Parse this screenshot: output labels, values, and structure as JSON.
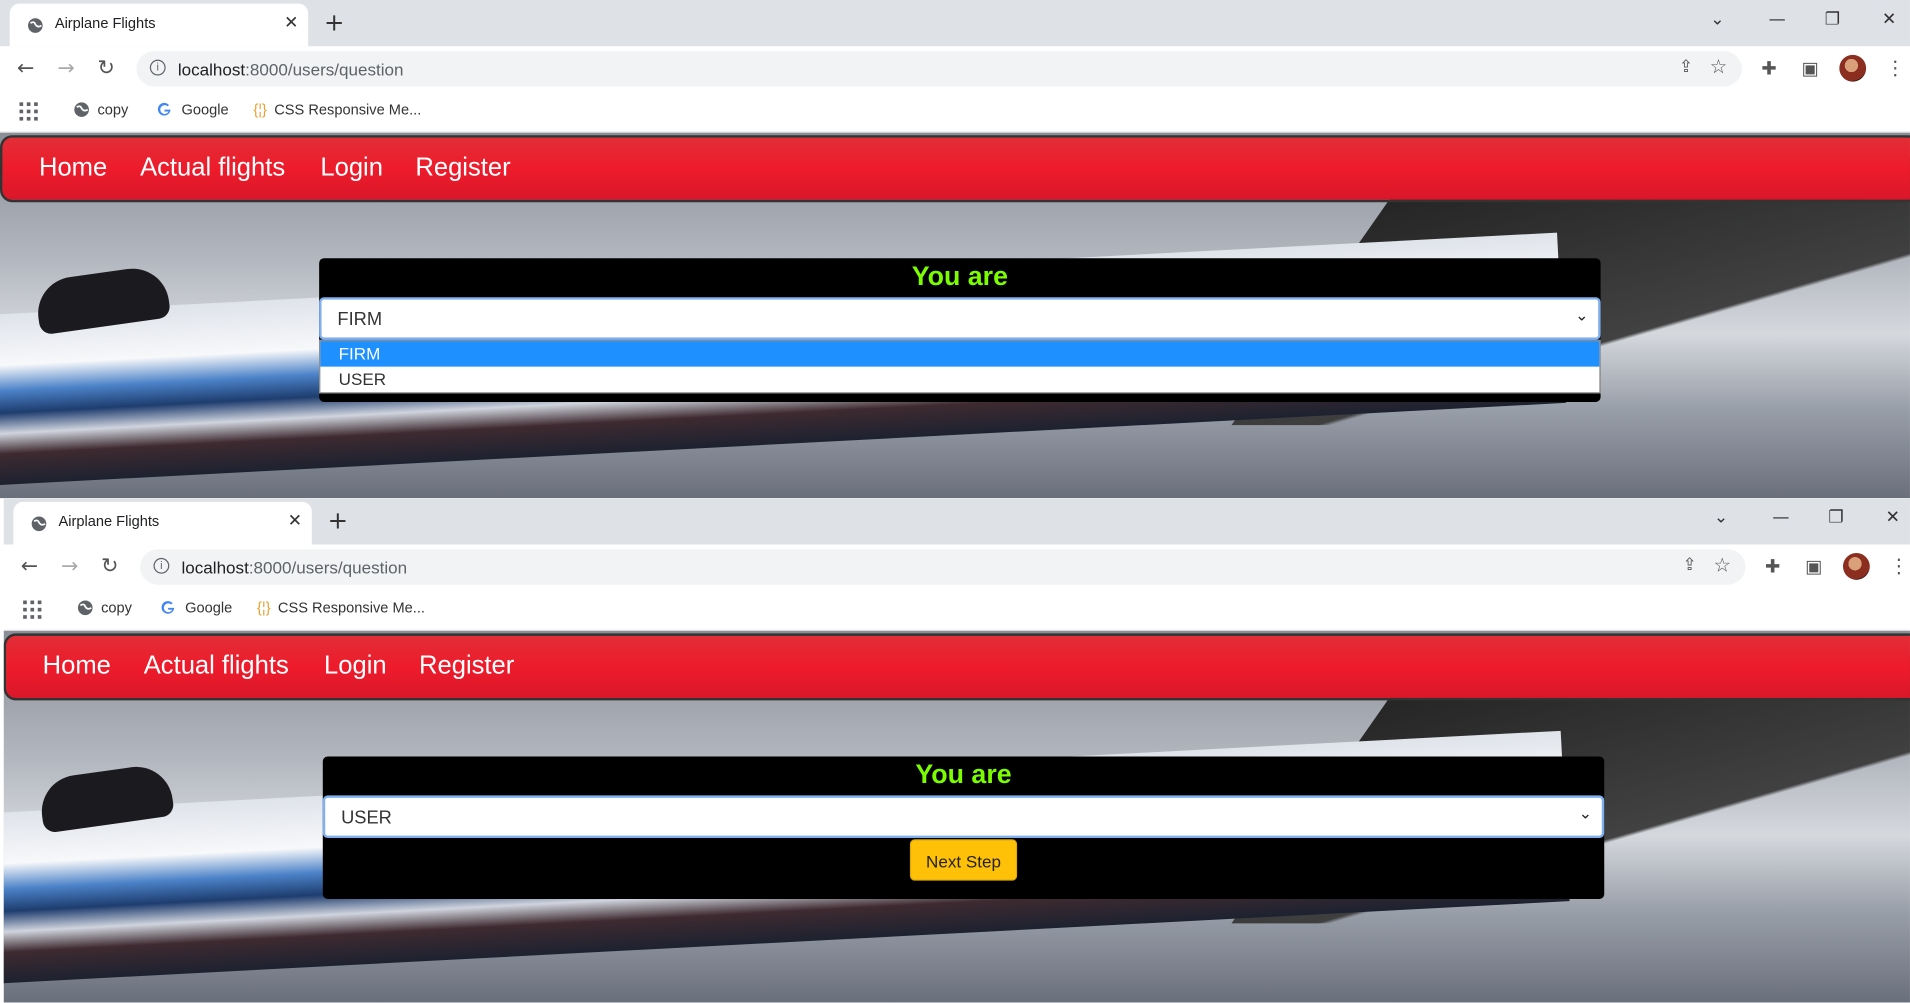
{
  "browser": {
    "tab_title": "Airplane Flights",
    "new_tab": "+",
    "url_host": "localhost",
    "url_rest": ":8000/users/question",
    "bookmarks": [
      {
        "label": "copy",
        "icon": "globe-icon"
      },
      {
        "label": "Google",
        "icon": "google-icon"
      },
      {
        "label": "CSS Responsive Me...",
        "icon": "braces-icon"
      }
    ],
    "icons": {
      "tab_close": "✕",
      "back": "←",
      "forward": "→",
      "reload": "↻",
      "share": "⇪",
      "star": "☆",
      "puzzle": "✚",
      "sidepanel": "▣",
      "kebab": "⋮",
      "minimize": "—",
      "restore": "❐",
      "close": "✕",
      "tab_search": "⌄"
    }
  },
  "site": {
    "nav": [
      "Home",
      "Actual flights",
      "Login",
      "Register"
    ],
    "nav_color": "#ee1b2b",
    "heading": "You are",
    "heading_color": "#7cfc00",
    "options": [
      "FIRM",
      "USER"
    ],
    "next_button": "Next Step",
    "button_color": "#ffc107"
  },
  "window1": {
    "select_value": "FIRM",
    "dropdown_open": true,
    "highlighted_option": "FIRM"
  },
  "window2": {
    "select_value": "USER",
    "dropdown_open": false
  }
}
